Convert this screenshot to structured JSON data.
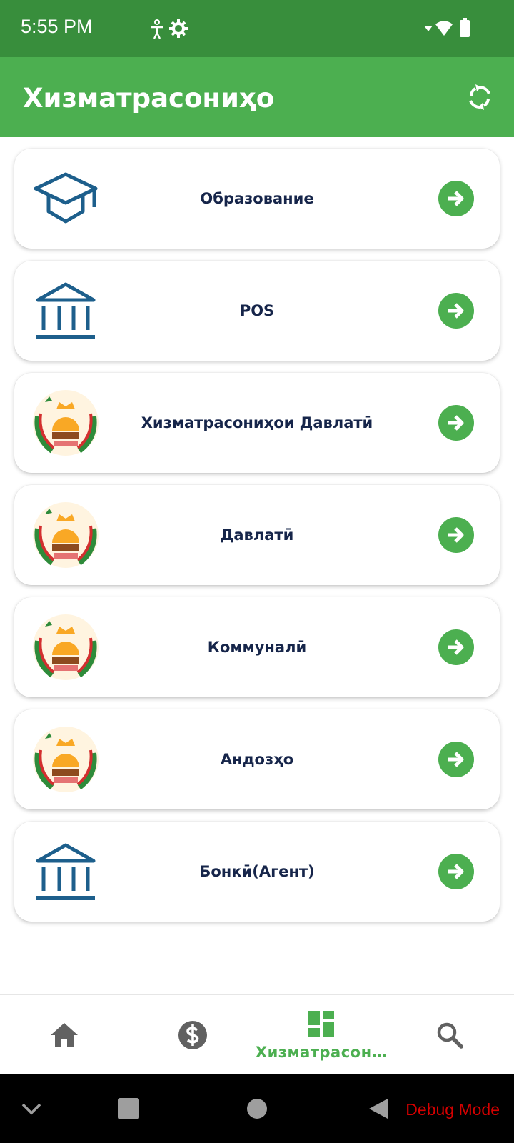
{
  "status_bar": {
    "time": "5:55 PM",
    "icons": [
      "accessibility-icon",
      "settings-icon",
      "wifi-icon",
      "battery-icon"
    ]
  },
  "app_bar": {
    "title": "Хизматрасониҳо",
    "refresh_icon": "refresh-icon"
  },
  "services": [
    {
      "label": "Образование",
      "icon": "graduation-cap-icon"
    },
    {
      "label": "POS",
      "icon": "bank-icon"
    },
    {
      "label": "Хизматрасониҳои Давлатӣ",
      "icon": "emblem-icon"
    },
    {
      "label": "Давлатӣ",
      "icon": "emblem-icon"
    },
    {
      "label": "Коммуналӣ",
      "icon": "emblem-icon"
    },
    {
      "label": "Андозҳо",
      "icon": "emblem-icon"
    },
    {
      "label": "Бонкӣ(Агент)",
      "icon": "bank-icon"
    }
  ],
  "bottom_nav": {
    "items": [
      {
        "icon": "home-icon",
        "label": ""
      },
      {
        "icon": "dollar-icon",
        "label": ""
      },
      {
        "icon": "dashboard-icon",
        "label": "Хизматрасон…",
        "active": true
      },
      {
        "icon": "search-icon",
        "label": ""
      }
    ]
  },
  "system_nav": {
    "debug_label": "Debug Mode"
  },
  "colors": {
    "status_bar": "#388e3c",
    "app_bar": "#4caf50",
    "accent": "#4caf50",
    "label_text": "#16254a",
    "icon_blue": "#1d5f8c",
    "debug_text": "#d50000"
  }
}
